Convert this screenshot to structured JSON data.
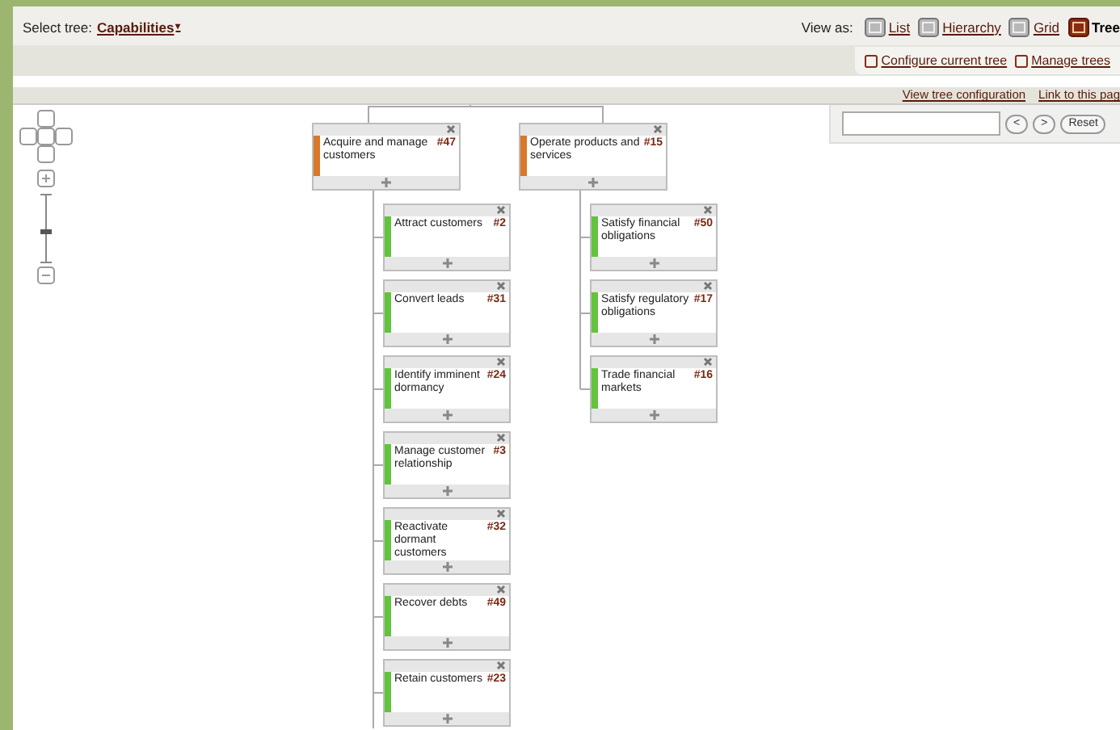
{
  "header": {
    "select_label": "Select tree:",
    "tree_name": "Capabilities",
    "caret": "▾",
    "view_label": "View as:",
    "views": [
      {
        "label": "List",
        "selected": false
      },
      {
        "label": "Hierarchy",
        "selected": false
      },
      {
        "label": "Grid",
        "selected": false
      },
      {
        "label": "Tree",
        "selected": true
      }
    ],
    "actions": [
      "Configure current tree",
      "Manage trees"
    ]
  },
  "toolbar": {
    "links": [
      "View tree configuration",
      "Link to this pag"
    ]
  },
  "search": {
    "buttons": [
      "<",
      ">",
      "Reset"
    ]
  },
  "zoom": {
    "level": 0.45
  },
  "tree": {
    "nodes": [
      {
        "title": "Acquire and manage customers",
        "number": "#47",
        "color": "#d9772a",
        "children": [
          {
            "title": "Attract customers",
            "number": "#2",
            "color": "#62c43c"
          },
          {
            "title": "Convert leads",
            "number": "#31",
            "color": "#62c43c"
          },
          {
            "title": "Identify imminent dormancy",
            "number": "#24",
            "color": "#62c43c"
          },
          {
            "title": "Manage customer relationship",
            "number": "#3",
            "color": "#62c43c"
          },
          {
            "title": "Reactivate dormant customers",
            "number": "#32",
            "color": "#62c43c"
          },
          {
            "title": "Recover debts",
            "number": "#49",
            "color": "#62c43c"
          },
          {
            "title": "Retain customers",
            "number": "#23",
            "color": "#62c43c"
          }
        ]
      },
      {
        "title": "Operate products and services",
        "number": "#15",
        "color": "#d9772a",
        "children": [
          {
            "title": "Satisfy financial obligations",
            "number": "#50",
            "color": "#62c43c"
          },
          {
            "title": "Satisfy regulatory obligations",
            "number": "#17",
            "color": "#62c43c"
          },
          {
            "title": "Trade financial markets",
            "number": "#16",
            "color": "#62c43c"
          }
        ]
      }
    ]
  }
}
